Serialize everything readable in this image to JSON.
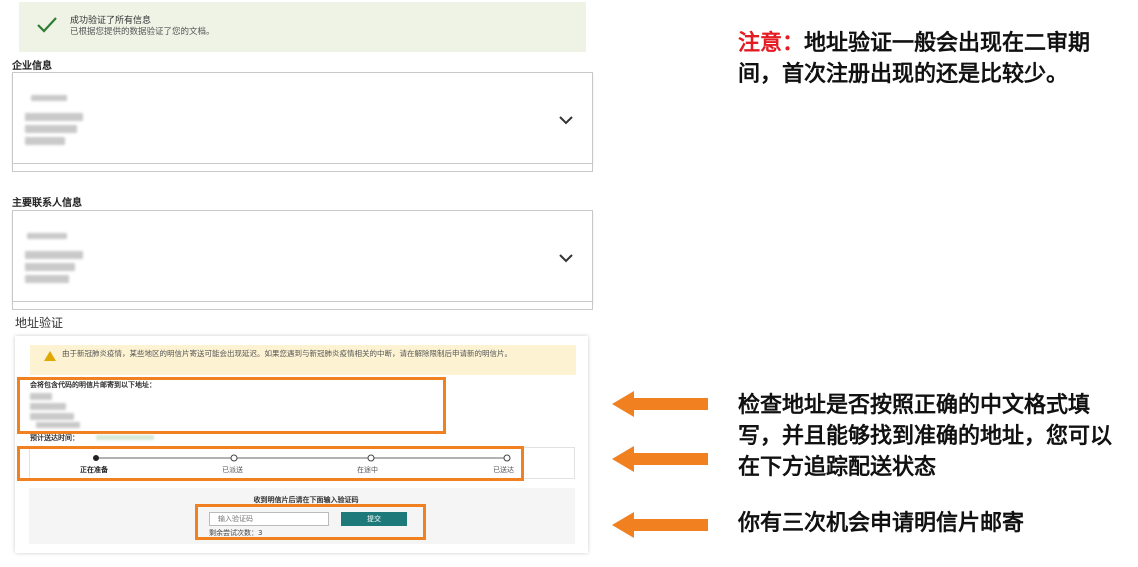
{
  "success": {
    "title": "成功验证了所有信息",
    "subtitle": "已根据您提供的数据验证了您的文档。"
  },
  "business_info": {
    "title": "企业信息"
  },
  "primary_contact": {
    "title": "主要联系人信息"
  },
  "address_verification": {
    "title": "地址验证",
    "warning": "由于新冠肺炎疫情，某些地区的明信片寄送可能会出现延迟。如果您遇到与新冠肺炎疫情相关的中断，请在解除限制后申请新的明信片。",
    "mail_to_label": "会将包含代码的明信片邮寄到以下地址：",
    "eta_label": "预计送达时间：",
    "steps": [
      "正在准备",
      "已派送",
      "在途中",
      "已送达"
    ],
    "code_prompt": "收到明信片后请在下面输入验证码",
    "code_placeholder": "输入验证码",
    "submit_label": "提交",
    "attempts_left": "剩余尝试次数：3"
  },
  "notes": {
    "warning_label": "注意：",
    "warning_text": "地址验证一般会出现在二审期间，首次注册出现的还是比较少。",
    "check_address": "检查地址是否按照正确的中文格式填写，并且能够找到准确的地址，您可以在下方追踪配送状态",
    "three_chances": "你有三次机会申请明信片邮寄"
  },
  "colors": {
    "accent_orange": "#f08020",
    "note_red": "#e41b23",
    "submit_teal": "#1e7a7a",
    "success_bg": "#eef3e6"
  },
  "icons": {
    "success": "check-icon",
    "warning": "warning-triangle-icon",
    "expand": "chevron-down-icon",
    "pointer": "arrow-left-icon"
  }
}
